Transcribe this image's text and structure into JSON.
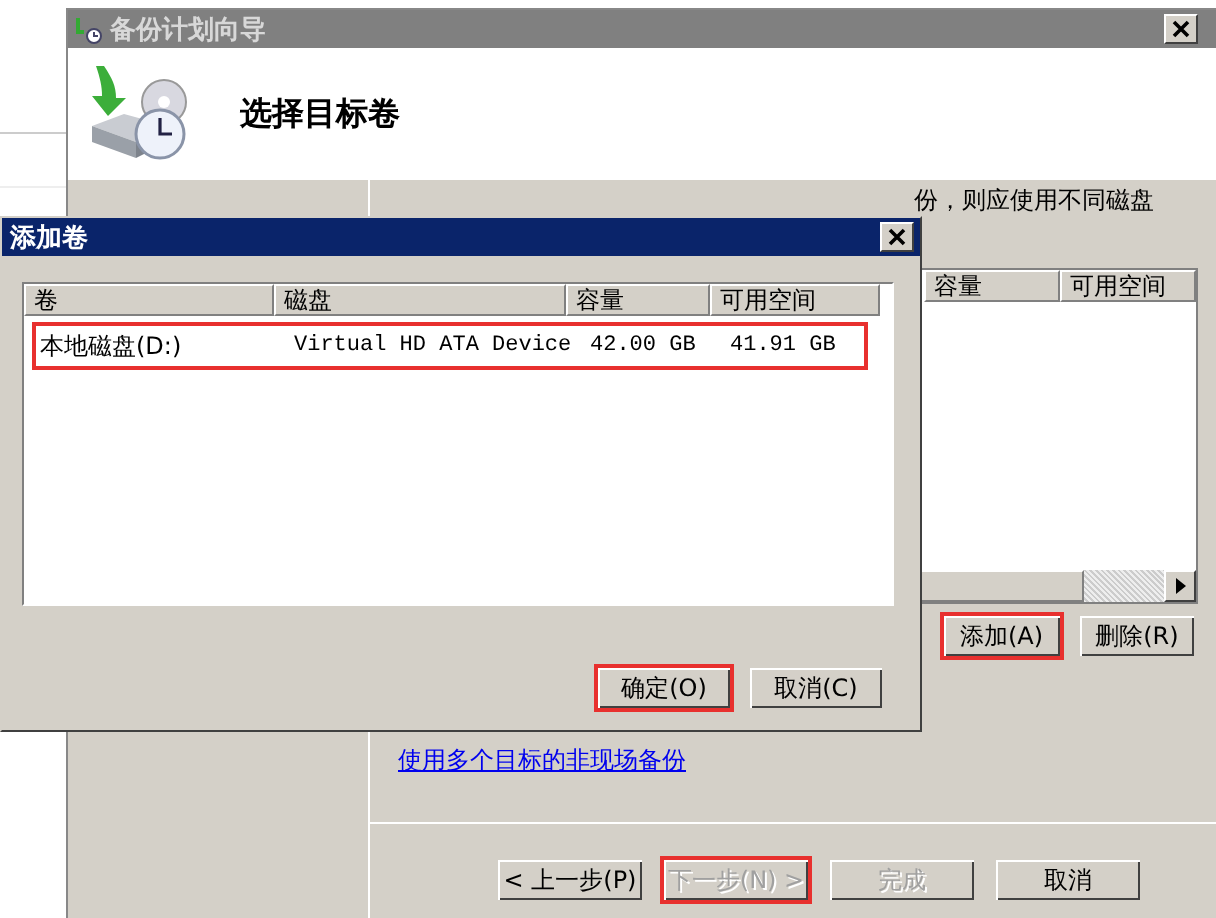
{
  "wizard": {
    "title": "备份计划向导",
    "heading": "选择目标卷",
    "description": "份，则应使用不同磁盘",
    "volume_list": {
      "columns": [
        "容量",
        "可用空间"
      ]
    },
    "list_buttons": [
      {
        "label": "添加(A)",
        "highlighted": true
      },
      {
        "label": "删除(R)",
        "highlighted": false
      }
    ],
    "link": "使用多个目标的非现场备份",
    "footer_buttons": [
      {
        "label": "< 上一步(P)",
        "disabled": false,
        "highlighted": false
      },
      {
        "label": "下一步(N) >",
        "disabled": true,
        "highlighted": true
      },
      {
        "label": "完成",
        "disabled": true,
        "highlighted": false
      },
      {
        "label": "取消",
        "disabled": false,
        "highlighted": false
      }
    ]
  },
  "dialog": {
    "title": "添加卷",
    "columns": [
      "卷",
      "磁盘",
      "容量",
      "可用空间"
    ],
    "rows": [
      {
        "cells": [
          "本地磁盘(D:)",
          "Virtual HD ATA Device",
          "42.00 GB",
          "41.91 GB"
        ],
        "highlighted": true
      }
    ],
    "buttons": [
      {
        "label": "确定(O)",
        "highlighted": true
      },
      {
        "label": "取消(C)",
        "highlighted": false
      }
    ]
  }
}
